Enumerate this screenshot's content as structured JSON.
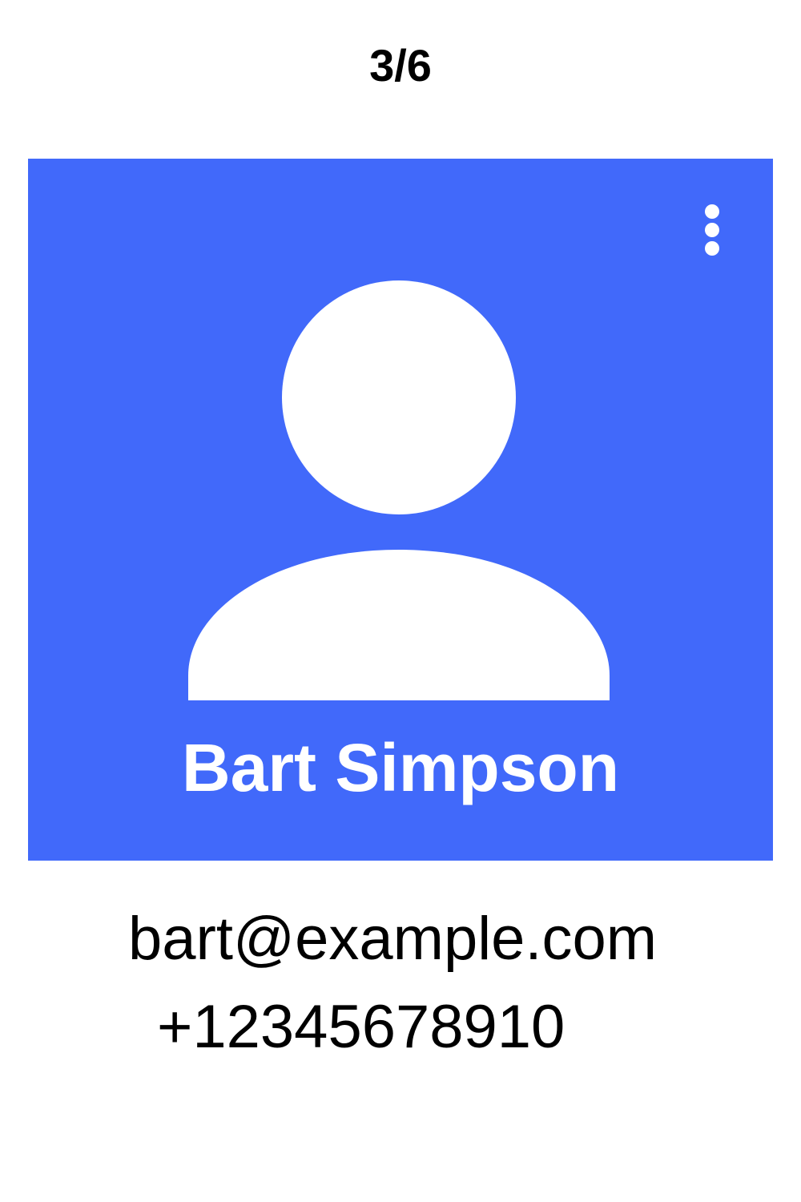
{
  "pager": {
    "text": "3/6"
  },
  "contact": {
    "name": "Bart Simpson",
    "email": "bart@example.com",
    "phone": "+12345678910"
  },
  "icons": {
    "menu": "more-vertical-icon",
    "avatar": "person-avatar-icon"
  },
  "colors": {
    "card_background": "#4169fa",
    "card_foreground": "#ffffff",
    "text": "#000000",
    "page_background": "#ffffff"
  }
}
